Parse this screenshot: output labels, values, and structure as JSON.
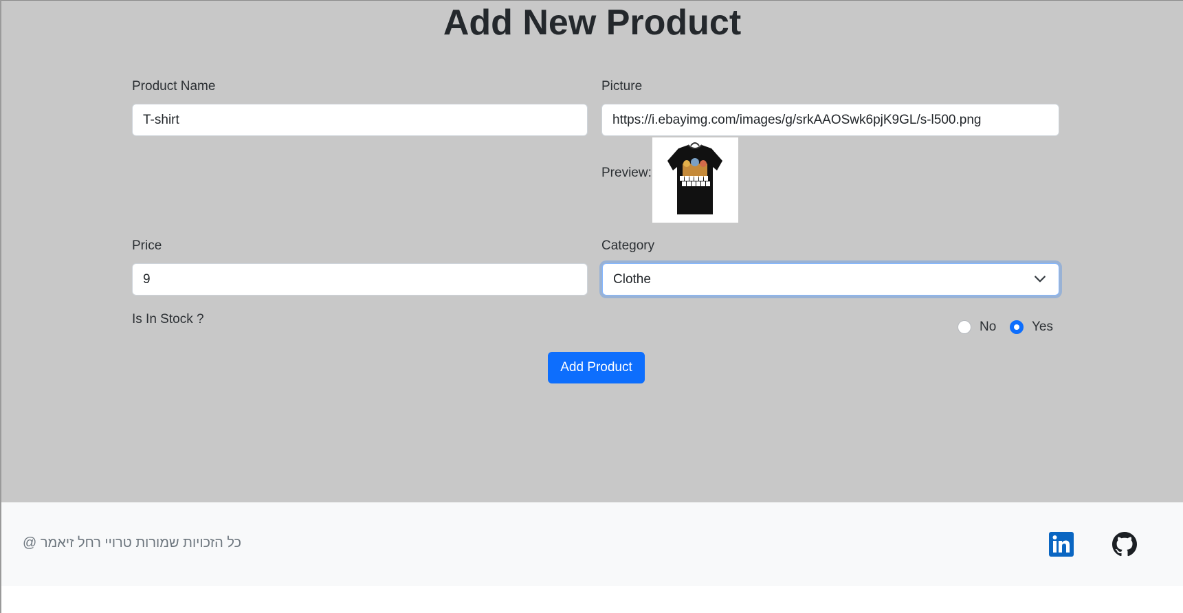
{
  "page": {
    "title": "Add New Product"
  },
  "form": {
    "product_name": {
      "label": "Product Name",
      "value": "T-shirt"
    },
    "picture": {
      "label": "Picture",
      "value": "https://i.ebayimg.com/images/g/srkAAOSwk6pjK9GL/s-l500.png",
      "preview_label": "Preview:",
      "preview_image_text": "CARTOON NETWORK"
    },
    "price": {
      "label": "Price",
      "value": "9"
    },
    "category": {
      "label": "Category",
      "selected": "Clothe"
    },
    "in_stock": {
      "label": "Is In Stock ?",
      "options": [
        {
          "label": "No",
          "checked": false
        },
        {
          "label": "Yes",
          "checked": true
        }
      ]
    },
    "submit_label": "Add Product"
  },
  "footer": {
    "copyright": "כל הזכויות שמורות טרויי רחל זיאמר @",
    "icons": [
      "linkedin-icon",
      "github-icon"
    ]
  },
  "colors": {
    "background": "#c8c8c8",
    "footer": "#f8f9fa",
    "primary": "#0d6efd",
    "linkedin": "#0a66c2",
    "github": "#1b1f23"
  }
}
